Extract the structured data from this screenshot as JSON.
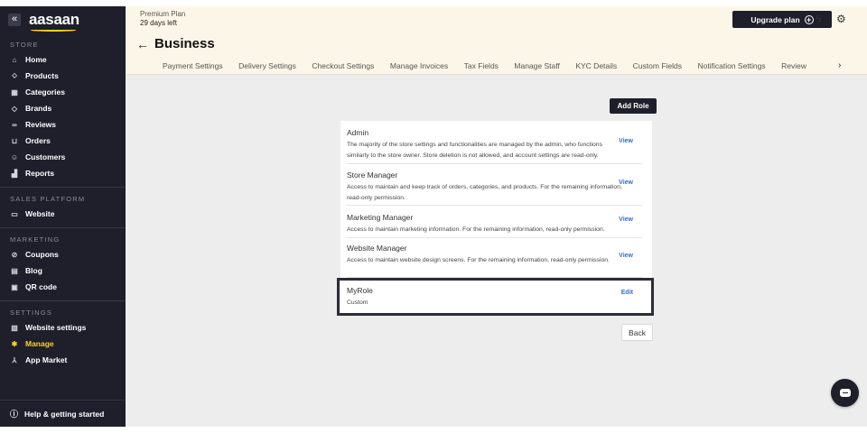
{
  "sidebar": {
    "logo": "aasaan",
    "collapse_icon": "«",
    "sections": {
      "store": "STORE",
      "sales_platform": "SALES PLATFORM",
      "marketing": "MARKETING",
      "settings": "SETTINGS"
    },
    "items": {
      "home": "Home",
      "products": "Products",
      "categories": "Categories",
      "brands": "Brands",
      "reviews": "Reviews",
      "orders": "Orders",
      "customers": "Customers",
      "reports": "Reports",
      "website": "Website",
      "coupons": "Coupons",
      "blog": "Blog",
      "qr_code": "QR code",
      "website_settings": "Website settings",
      "manage": "Manage",
      "app_market": "App Market"
    },
    "help": "Help & getting started",
    "active_item": "manage",
    "accent_color": "#ffd21f"
  },
  "header": {
    "plan_name": "Premium Plan",
    "days_left": "29 days left",
    "upgrade_label": "Upgrade plan",
    "page_title": "Business",
    "tabs": [
      "Payment Settings",
      "Delivery Settings",
      "Checkout Settings",
      "Manage Invoices",
      "Tax Fields",
      "Manage Staff",
      "KYC Details",
      "Custom Fields",
      "Notification Settings",
      "Review"
    ]
  },
  "content": {
    "add_role_label": "Add Role",
    "back_label": "Back",
    "roles": [
      {
        "name": "Admin",
        "description": "The majority of the store settings and functionalities are managed by the admin, who functions similarly to the store owner. Store deletion is not allowed, and account settings are read-only.",
        "action": "View"
      },
      {
        "name": "Store Manager",
        "description": "Access to maintain and keep track of orders, categories, and products. For the remaining information, read-only permission.",
        "action": "View"
      },
      {
        "name": "Marketing Manager",
        "description": "Access to maintain marketing information. For the remaining information, read-only permission.",
        "action": "View"
      },
      {
        "name": "Website Manager",
        "description": "Access to maintain website design screens. For the remaining information, read-only permission.",
        "action": "View"
      },
      {
        "name": "MyRole",
        "description": "Custom",
        "action": "Edit"
      }
    ]
  },
  "colors": {
    "sidebar_bg": "#1e1f2b",
    "header_bg": "#fcf6e8",
    "link": "#2f6fd1"
  }
}
